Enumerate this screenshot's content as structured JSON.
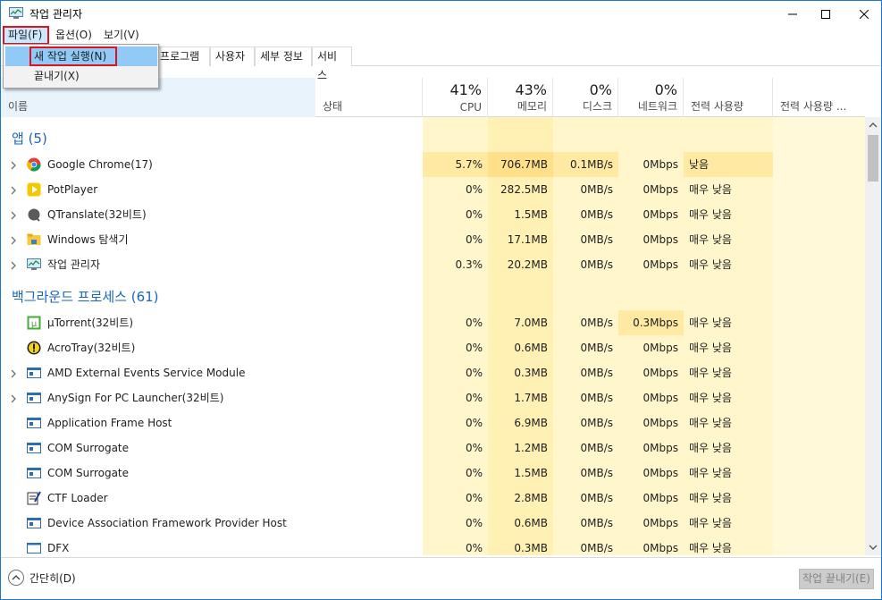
{
  "window": {
    "title": "작업 관리자"
  },
  "menu": {
    "file": "파일(F)",
    "options": "옵션(O)",
    "view": "보기(V)"
  },
  "file_menu": {
    "run_new_task": "새 작업 실행(N)",
    "exit": "끝내기(X)"
  },
  "tabs": [
    "앱 프로그램",
    "사용자",
    "세부 정보",
    "서비스"
  ],
  "tab_partial": "앱프로그램",
  "header": {
    "name": "이름",
    "status": "상태",
    "cpu_pct": "41%",
    "cpu": "CPU",
    "mem_pct": "43%",
    "mem": "메모리",
    "disk_pct": "0%",
    "disk": "디스크",
    "net_pct": "0%",
    "net": "네트워크",
    "power": "전력 사용량",
    "power_trend": "전력 사용량 ..."
  },
  "groups": {
    "apps": "앱 (5)",
    "background": "백그라운드 프로세스 (61)"
  },
  "apps": [
    {
      "name": "Google Chrome(17)",
      "icon": "chrome-icon",
      "cpu": "5.7%",
      "mem": "706.7MB",
      "disk": "0.1MB/s",
      "net": "0Mbps",
      "power": "낮음"
    },
    {
      "name": "PotPlayer",
      "icon": "potplayer-icon",
      "cpu": "0%",
      "mem": "282.5MB",
      "disk": "0MB/s",
      "net": "0Mbps",
      "power": "매우 낮음"
    },
    {
      "name": "QTranslate(32비트)",
      "icon": "qtranslate-icon",
      "cpu": "0%",
      "mem": "1.5MB",
      "disk": "0MB/s",
      "net": "0Mbps",
      "power": "매우 낮음"
    },
    {
      "name": "Windows 탐색기",
      "icon": "explorer-icon",
      "cpu": "0%",
      "mem": "17.1MB",
      "disk": "0MB/s",
      "net": "0Mbps",
      "power": "매우 낮음"
    },
    {
      "name": "작업 관리자",
      "icon": "taskmgr-icon",
      "cpu": "0.3%",
      "mem": "20.2MB",
      "disk": "0MB/s",
      "net": "0Mbps",
      "power": "매우 낮음"
    }
  ],
  "background": [
    {
      "name": "µTorrent(32비트)",
      "icon": "utorrent-icon",
      "cpu": "0%",
      "mem": "7.0MB",
      "disk": "0MB/s",
      "net": "0.3Mbps",
      "power": "매우 낮음"
    },
    {
      "name": "AcroTray(32비트)",
      "icon": "acrotray-icon",
      "cpu": "0%",
      "mem": "0.6MB",
      "disk": "0MB/s",
      "net": "0Mbps",
      "power": "매우 낮음"
    },
    {
      "name": "AMD External Events Service Module",
      "icon": "service-icon",
      "cpu": "0%",
      "mem": "0.3MB",
      "disk": "0MB/s",
      "net": "0Mbps",
      "power": "매우 낮음"
    },
    {
      "name": "AnySign For PC Launcher(32비트)",
      "icon": "service-icon",
      "cpu": "0%",
      "mem": "1.7MB",
      "disk": "0MB/s",
      "net": "0Mbps",
      "power": "매우 낮음"
    },
    {
      "name": "Application Frame Host",
      "icon": "service-icon",
      "cpu": "0%",
      "mem": "6.9MB",
      "disk": "0MB/s",
      "net": "0Mbps",
      "power": "매우 낮음"
    },
    {
      "name": "COM Surrogate",
      "icon": "service-icon",
      "cpu": "0%",
      "mem": "1.2MB",
      "disk": "0MB/s",
      "net": "0Mbps",
      "power": "매우 낮음"
    },
    {
      "name": "COM Surrogate",
      "icon": "service-icon",
      "cpu": "0%",
      "mem": "1.5MB",
      "disk": "0MB/s",
      "net": "0Mbps",
      "power": "매우 낮음"
    },
    {
      "name": "CTF Loader",
      "icon": "ctf-icon",
      "cpu": "0%",
      "mem": "2.8MB",
      "disk": "0MB/s",
      "net": "0Mbps",
      "power": "매우 낮음"
    },
    {
      "name": "Device Association Framework Provider Host",
      "icon": "service-icon",
      "cpu": "0%",
      "mem": "0.6MB",
      "disk": "0MB/s",
      "net": "0Mbps",
      "power": "매우 낮음"
    },
    {
      "name": "DFX",
      "icon": "window-icon",
      "cpu": "0%",
      "mem": "0.3MB",
      "disk": "0MB/s",
      "net": "0Mbps",
      "power": "매우 낮음"
    }
  ],
  "footer": {
    "collapse": "간단히(D)",
    "end_task": "작업 끝내기(E)"
  },
  "colors": {
    "accent": "#1979ca",
    "group_title": "#1a66b8",
    "heat_light": "#fff4c4",
    "heat_mid": "#ffe9a3",
    "highlight_red": "#e0121a",
    "menu_highlight": "#91c9f7"
  }
}
